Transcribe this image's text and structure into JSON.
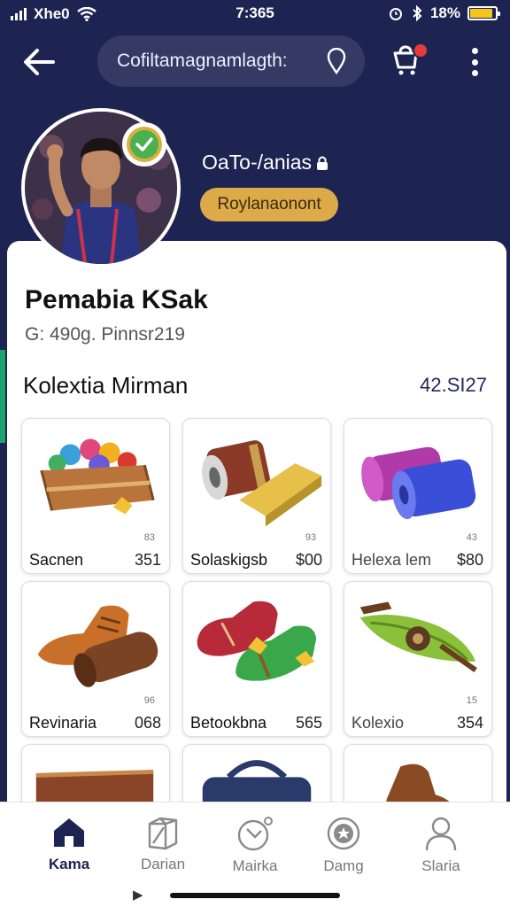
{
  "status_bar": {
    "carrier": "Xhe0",
    "time": "7:365",
    "battery": "18%",
    "battery_level": 0.9
  },
  "header": {
    "search_text": "Cofiltamagnamlagth:",
    "handle": "OaTo-/anias",
    "rank_badge": "Roylanaonont"
  },
  "profile": {
    "name": "Pemabia KSak",
    "subtitle": "G: 490g. Pinnsr219"
  },
  "collection": {
    "title": "Kolextia Mirman",
    "count": "42.SI27",
    "items": [
      {
        "name": "Sacnen",
        "price": "351",
        "mini": "83"
      },
      {
        "name": "Solaskigsb",
        "price": "$00",
        "mini": "93"
      },
      {
        "name": "Helexa lem",
        "price": "$80",
        "mini": "43"
      },
      {
        "name": "Revinaria",
        "price": "068",
        "mini": "96"
      },
      {
        "name": "Betookbna",
        "price": "565",
        "mini": ""
      },
      {
        "name": "Kolexio",
        "price": "354",
        "mini": "15"
      }
    ]
  },
  "bottom_nav": [
    {
      "label": "Kama",
      "icon": "home-icon",
      "active": true
    },
    {
      "label": "Darian",
      "icon": "box-icon",
      "active": false
    },
    {
      "label": "Mairka",
      "icon": "stopwatch-icon",
      "active": false
    },
    {
      "label": "Damg",
      "icon": "badge-icon",
      "active": false
    },
    {
      "label": "Slaria",
      "icon": "profile-icon",
      "active": false
    }
  ],
  "colors": {
    "background": "#1e2452",
    "badge": "#dcaa48",
    "accent": "#1aa36b",
    "verified": "#4caf50"
  }
}
